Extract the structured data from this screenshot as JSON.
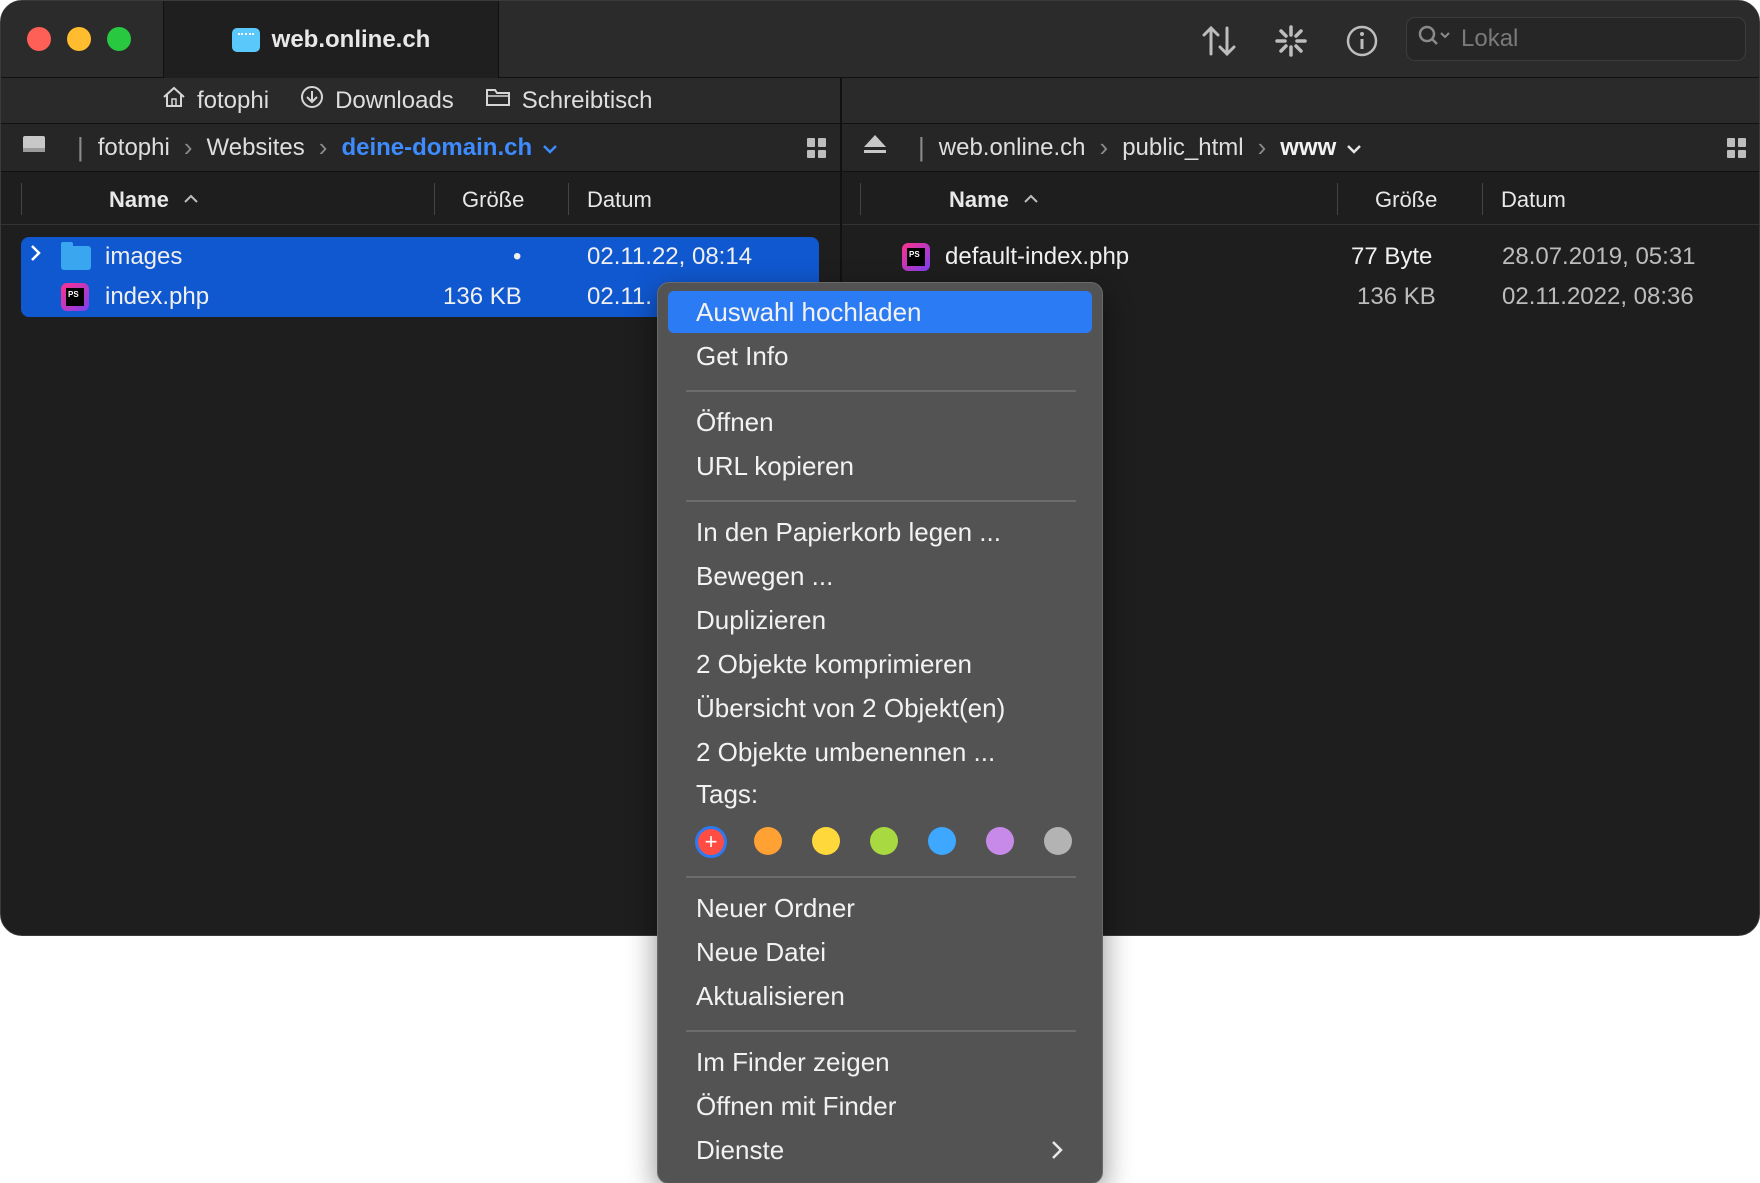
{
  "window": {
    "tab_title": "web.online.ch",
    "search_placeholder": "Lokal"
  },
  "toolbar": {
    "sort_icon": "arrows-up-down-icon",
    "activity_icon": "activity-spinner-icon",
    "info_icon": "info-icon",
    "search_icon": "search-icon"
  },
  "favorites": [
    {
      "icon": "home-icon",
      "label": "fotophi"
    },
    {
      "icon": "download-icon",
      "label": "Downloads"
    },
    {
      "icon": "folder-icon",
      "label": "Schreibtisch"
    }
  ],
  "left_pane": {
    "breadcrumb": [
      "fotophi",
      "Websites",
      "deine-domain.ch"
    ],
    "columns": {
      "name": "Name",
      "size": "Größe",
      "date": "Datum"
    },
    "files": [
      {
        "name": "images",
        "size": "•",
        "date": "02.11.22, 08:14",
        "type": "folder"
      },
      {
        "name": "index.php",
        "size": "136 KB",
        "date": "02.11.",
        "type": "php"
      }
    ]
  },
  "right_pane": {
    "breadcrumb": [
      "web.online.ch",
      "public_html",
      "www"
    ],
    "columns": {
      "name": "Name",
      "size": "Größe",
      "date": "Datum"
    },
    "files": [
      {
        "name": "default-index.php",
        "size": "77 Byte",
        "date": "28.07.2019, 05:31",
        "type": "php"
      },
      {
        "name": "",
        "size": "136 KB",
        "date": "02.11.2022, 08:36",
        "type": "php"
      }
    ]
  },
  "context_menu": {
    "upload": "Auswahl hochladen",
    "get_info": "Get Info",
    "open": "Öffnen",
    "copy_url": "URL kopieren",
    "trash": "In den Papierkorb legen ...",
    "move": "Bewegen ...",
    "duplicate": "Duplizieren",
    "compress": "2 Objekte komprimieren",
    "overview": "Übersicht von 2 Objekt(en)",
    "rename": "2 Objekte umbenennen ...",
    "tags_label": "Tags:",
    "tag_colors": [
      "#ff4d43",
      "#ffa233",
      "#ffd93b",
      "#a8d940",
      "#3ea7ff",
      "#c78ae8",
      "#b3b3b3"
    ],
    "new_folder": "Neuer Ordner",
    "new_file": "Neue Datei",
    "refresh": "Aktualisieren",
    "show_in_finder": "Im Finder zeigen",
    "open_with_finder": "Öffnen mit Finder",
    "services": "Dienste"
  }
}
